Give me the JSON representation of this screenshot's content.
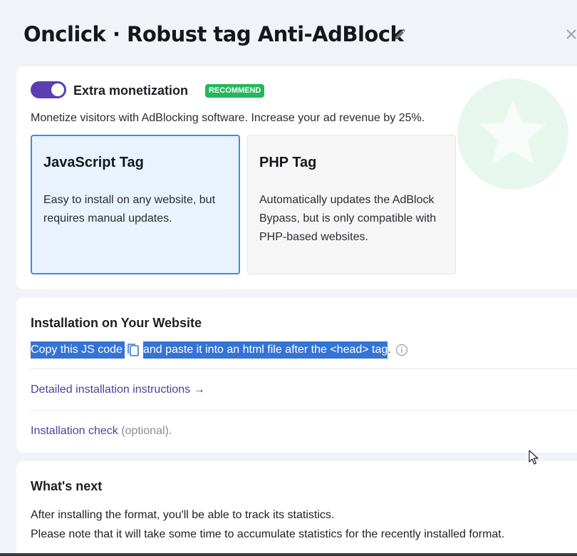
{
  "header": {
    "title": "Onclick · Robust tag Anti-AdBlock"
  },
  "monetization": {
    "label": "Extra monetization",
    "badge": "RECOMMEND",
    "toggle_on": true,
    "description": "Monetize visitors with AdBlocking software. Increase your ad revenue by 25%.",
    "options": [
      {
        "title": "JavaScript Tag",
        "desc": "Easy to install on any website, but requires manual updates.",
        "selected": true
      },
      {
        "title": "PHP Tag",
        "desc": "Automatically updates the AdBlock Bypass, but is only compatible with PHP-based websites.",
        "selected": false
      }
    ]
  },
  "installation": {
    "title": "Installation on Your Website",
    "copy_prefix": "Copy this JS code",
    "copy_middle": "and paste it into an html file after the <head> ta",
    "copy_highlight_end": "g",
    "copy_suffix": ".",
    "instructions_link": "Detailed installation instructions →",
    "check_link": "Installation check",
    "check_optional": "(optional)."
  },
  "next": {
    "title": "What's next",
    "line1": "After installing the format, you'll be able to track its statistics.",
    "line2": "Please note that it will take some time to accumulate statistics for the recently installed format."
  },
  "colors": {
    "accent": "#5b3fb0",
    "badge_green": "#23b85c",
    "selected_border": "#3d8fe0",
    "selection_highlight": "#3573d4",
    "link": "#4b3fa0"
  },
  "icons": [
    "pencil-icon",
    "close-icon",
    "star-icon",
    "copy-icon",
    "info-icon",
    "mouse-cursor-icon"
  ]
}
